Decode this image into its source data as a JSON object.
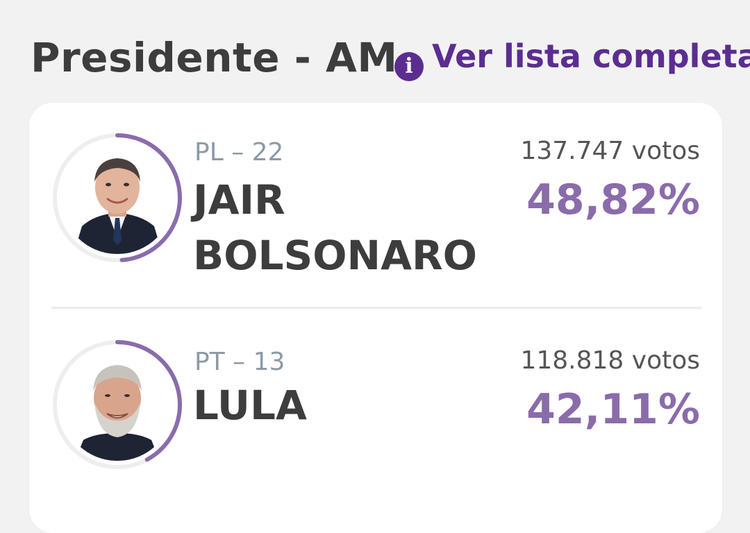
{
  "header": {
    "title": "Presidente - AM",
    "info_icon": "i",
    "full_list_label": "Ver lista completa"
  },
  "colors": {
    "accent": "#5b2d91",
    "percent": "#8a6cab",
    "ring": "#8a6cab",
    "ring_track": "#eeeeee"
  },
  "candidates": [
    {
      "party": "PL – 22",
      "name": "JAIR BOLSONARO",
      "votes": "137.747 votos",
      "percent": "48,82%",
      "percent_value": 48.82,
      "photo_icon": "candidate-photo"
    },
    {
      "party": "PT – 13",
      "name": "LULA",
      "votes": "118.818 votos",
      "percent": "42,11%",
      "percent_value": 42.11,
      "photo_icon": "candidate-photo"
    }
  ]
}
